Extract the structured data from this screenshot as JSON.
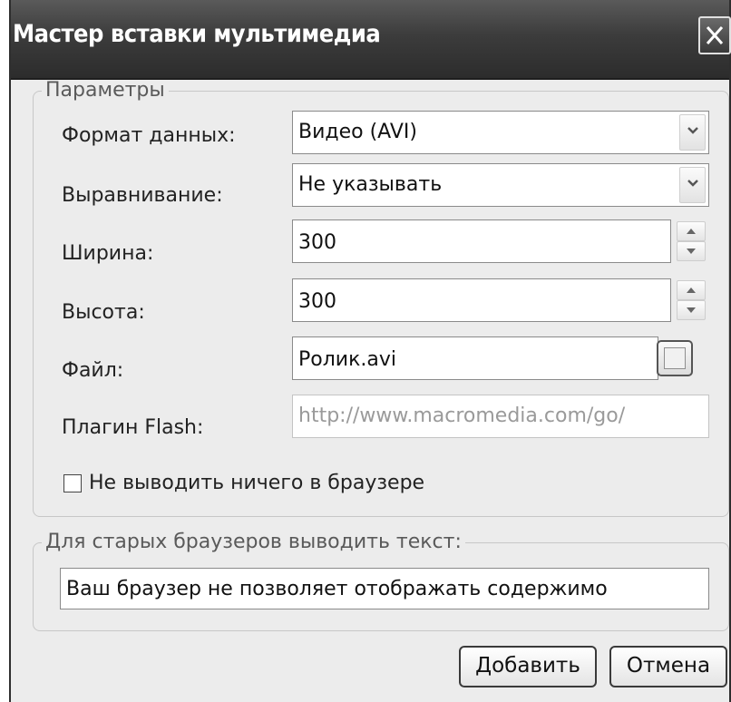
{
  "window": {
    "title": "Мастер вставки мультимедиа"
  },
  "params": {
    "legend": "Параметры",
    "format": {
      "label": "Формат данных:",
      "value": "Видео (AVI)"
    },
    "align": {
      "label": "Выравнивание:",
      "value": "Не указывать"
    },
    "width": {
      "label": "Ширина:",
      "value": "300"
    },
    "height": {
      "label": "Высота:",
      "value": "300"
    },
    "file": {
      "label": "Файл:",
      "value": "Ролик.avi"
    },
    "flash": {
      "label": "Плагин Flash:",
      "value": "http://www.macromedia.com/go/"
    },
    "no_output": {
      "label": "Не выводить ничего в браузере",
      "checked": false
    }
  },
  "old_browsers": {
    "legend": "Для старых браузеров выводить текст:",
    "value": "Ваш браузер не позволяет отображать содержимо"
  },
  "buttons": {
    "add": "Добавить",
    "cancel": "Отмена"
  },
  "icons": {
    "close": "close-icon",
    "dropdown": "chevron-down-icon",
    "spin_up": "chevron-up-icon",
    "spin_down": "chevron-down-icon",
    "browse": "folder-icon"
  }
}
